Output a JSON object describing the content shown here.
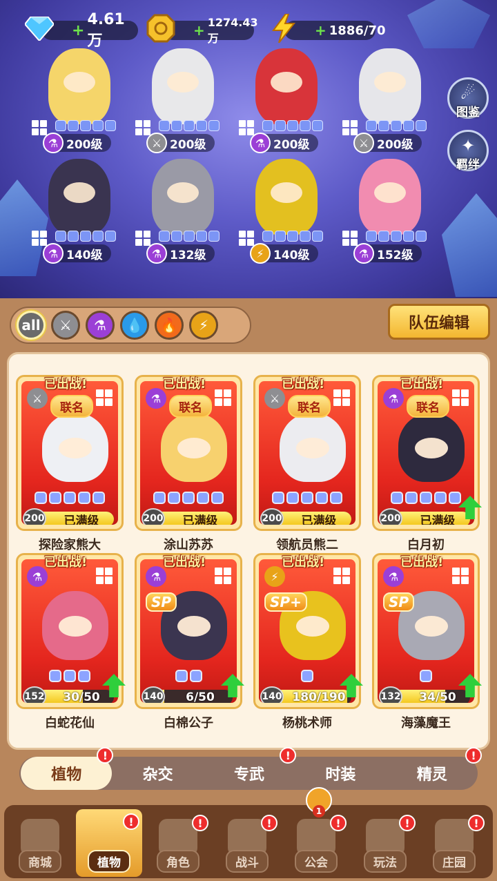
{
  "resources": {
    "gems": "4.61万",
    "coins": "1274.43万",
    "energy": "1886/70"
  },
  "side_buttons": {
    "codex_label": "图鉴",
    "bond_label": "羁绊"
  },
  "team": [
    {
      "level": "200级",
      "element": "magic",
      "color": "#f5d56a"
    },
    {
      "level": "200级",
      "element": "physical",
      "color": "#e8e8ea"
    },
    {
      "level": "200级",
      "element": "magic",
      "color": "#d8343a"
    },
    {
      "level": "200级",
      "element": "physical",
      "color": "#e6e6ea"
    },
    {
      "level": "140级",
      "element": "magic",
      "color": "#3a3450"
    },
    {
      "level": "132级",
      "element": "magic",
      "color": "#9a9aa6"
    },
    {
      "level": "140级",
      "element": "lightning",
      "color": "#e3c020"
    },
    {
      "level": "152级",
      "element": "magic",
      "color": "#f18cb0"
    }
  ],
  "filters": {
    "all_label": "all",
    "icons": [
      "sword-icon",
      "potion-icon",
      "water-drop-icon",
      "fire-icon",
      "lightning-icon"
    ]
  },
  "team_edit_label": "队伍编辑",
  "cards": [
    {
      "name": "探险家熊大",
      "deployed": "已出战!",
      "linked": "联名",
      "level": "200",
      "progress": "已满级",
      "element": "physical",
      "color": "#eef0f4",
      "sp": ""
    },
    {
      "name": "涂山苏苏",
      "deployed": "已出战!",
      "linked": "联名",
      "level": "200",
      "progress": "已满级",
      "element": "magic",
      "color": "#f7d16e",
      "sp": ""
    },
    {
      "name": "领航员熊二",
      "deployed": "已出战!",
      "linked": "联名",
      "level": "200",
      "progress": "已满级",
      "element": "physical",
      "color": "#ececf0",
      "sp": ""
    },
    {
      "name": "白月初",
      "deployed": "已出战!",
      "linked": "联名",
      "level": "200",
      "progress": "已满级",
      "element": "magic",
      "color": "#2e2a3e",
      "sp": ""
    },
    {
      "name": "白蛇花仙",
      "deployed": "已出战!",
      "linked": "",
      "level": "152",
      "progress": "30/50",
      "element": "magic",
      "color": "#e56a8a",
      "sp": ""
    },
    {
      "name": "白棉公子",
      "deployed": "已出战!",
      "linked": "",
      "level": "140",
      "progress": "6/50",
      "element": "magic",
      "color": "#3b3550",
      "sp": "SP"
    },
    {
      "name": "杨桃术师",
      "deployed": "已出战!",
      "linked": "",
      "level": "140",
      "progress": "180/190",
      "element": "lightning",
      "color": "#e8c21e",
      "sp": "SP+"
    },
    {
      "name": "海藻魔王",
      "deployed": "已出战!",
      "linked": "",
      "level": "132",
      "progress": "34/50",
      "element": "magic",
      "color": "#a9a9b4",
      "sp": "SP"
    }
  ],
  "sub_tabs": [
    "植物",
    "杂交",
    "专武",
    "时装",
    "精灵"
  ],
  "nav": [
    {
      "label": "商城"
    },
    {
      "label": "植物"
    },
    {
      "label": "角色"
    },
    {
      "label": "战斗"
    },
    {
      "label": "公会"
    },
    {
      "label": "玩法"
    },
    {
      "label": "庄园"
    }
  ],
  "nav_badge": "1",
  "alert_mark": "!"
}
